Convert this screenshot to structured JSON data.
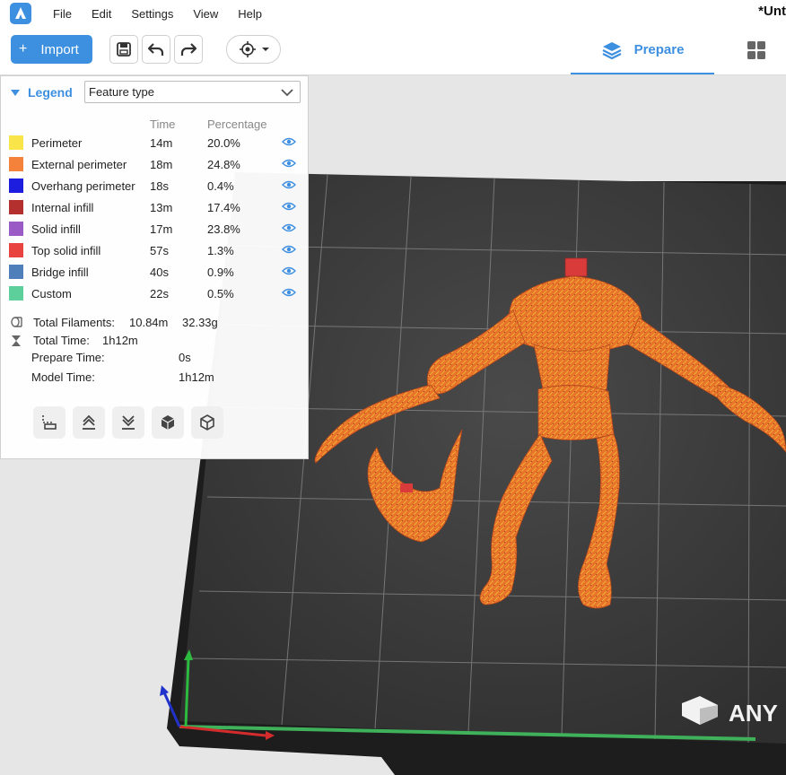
{
  "menu": {
    "items": [
      "File",
      "Edit",
      "Settings",
      "View",
      "Help"
    ],
    "doc_title": "*Unt"
  },
  "toolbar": {
    "import_label": "Import",
    "prepare_label": "Prepare"
  },
  "legend": {
    "title": "Legend",
    "view_mode": "Feature type",
    "col_time": "Time",
    "col_percentage": "Percentage",
    "rows": [
      {
        "label": "Perimeter",
        "time": "14m",
        "pct": "20.0%",
        "color": "#f9e54a"
      },
      {
        "label": "External perimeter",
        "time": "18m",
        "pct": "24.8%",
        "color": "#f5823a"
      },
      {
        "label": "Overhang perimeter",
        "time": "18s",
        "pct": "0.4%",
        "color": "#1d1ddf"
      },
      {
        "label": "Internal infill",
        "time": "13m",
        "pct": "17.4%",
        "color": "#b3302f"
      },
      {
        "label": "Solid infill",
        "time": "17m",
        "pct": "23.8%",
        "color": "#9b5bc6"
      },
      {
        "label": "Top solid infill",
        "time": "57s",
        "pct": "1.3%",
        "color": "#e8433f"
      },
      {
        "label": "Bridge infill",
        "time": "40s",
        "pct": "0.9%",
        "color": "#4f7fba"
      },
      {
        "label": "Custom",
        "time": "22s",
        "pct": "0.5%",
        "color": "#5ccf9a"
      }
    ],
    "total_filaments_label": "Total Filaments:",
    "total_filaments_length": "10.84m",
    "total_filaments_weight": "32.33g",
    "total_time_label": "Total Time:",
    "total_time": "1h12m",
    "prepare_time_label": "Prepare Time:",
    "prepare_time": "0s",
    "model_time_label": "Model Time:",
    "model_time": "1h12m"
  },
  "viewport": {
    "plate_brand": "ANY",
    "accent_color": "#3d8fe0",
    "model_color": "#e8742c"
  }
}
